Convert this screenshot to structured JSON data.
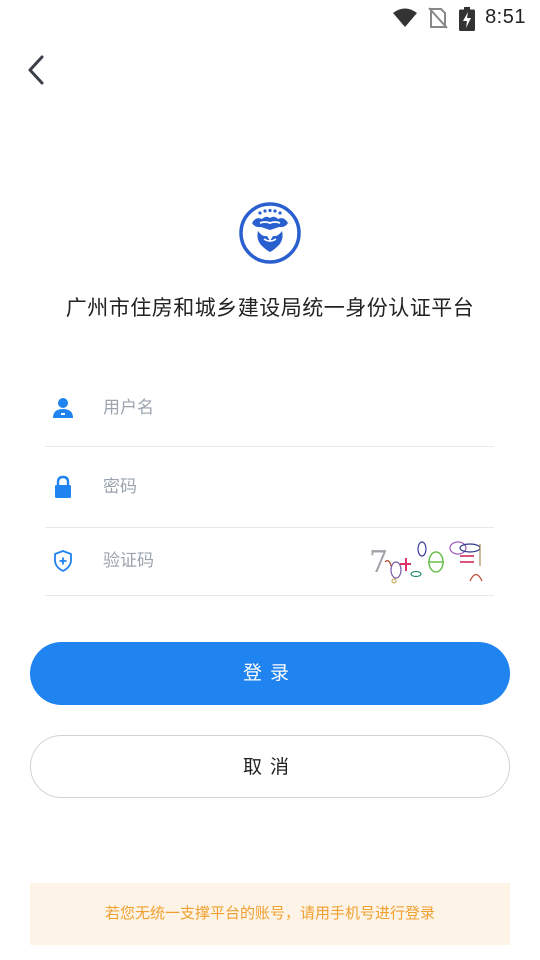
{
  "status_bar": {
    "time": "8:51",
    "icons": [
      "wifi-icon",
      "no-sim-icon",
      "battery-charging-icon"
    ]
  },
  "nav": {
    "back_icon": "chevron-left-icon"
  },
  "header": {
    "logo_icon": "bureau-emblem-icon",
    "title": "广州市住房和城乡建设局统一身份认证平台"
  },
  "form": {
    "username": {
      "icon": "user-icon",
      "placeholder": "用户名",
      "value": ""
    },
    "password": {
      "icon": "lock-icon",
      "placeholder": "密码",
      "value": ""
    },
    "captcha": {
      "icon": "shield-plus-icon",
      "placeholder": "验证码",
      "value": "",
      "image_text": "7"
    }
  },
  "buttons": {
    "login_label": "登录",
    "cancel_label": "取消"
  },
  "notice": {
    "text": "若您无统一支撑平台的账号，请用手机号进行登录"
  },
  "colors": {
    "primary": "#1f83f0",
    "notice_bg": "#fdf4e7",
    "notice_text": "#f0a030",
    "icon_blue": "#1f83f0",
    "logo_blue": "#2a5fd0"
  }
}
